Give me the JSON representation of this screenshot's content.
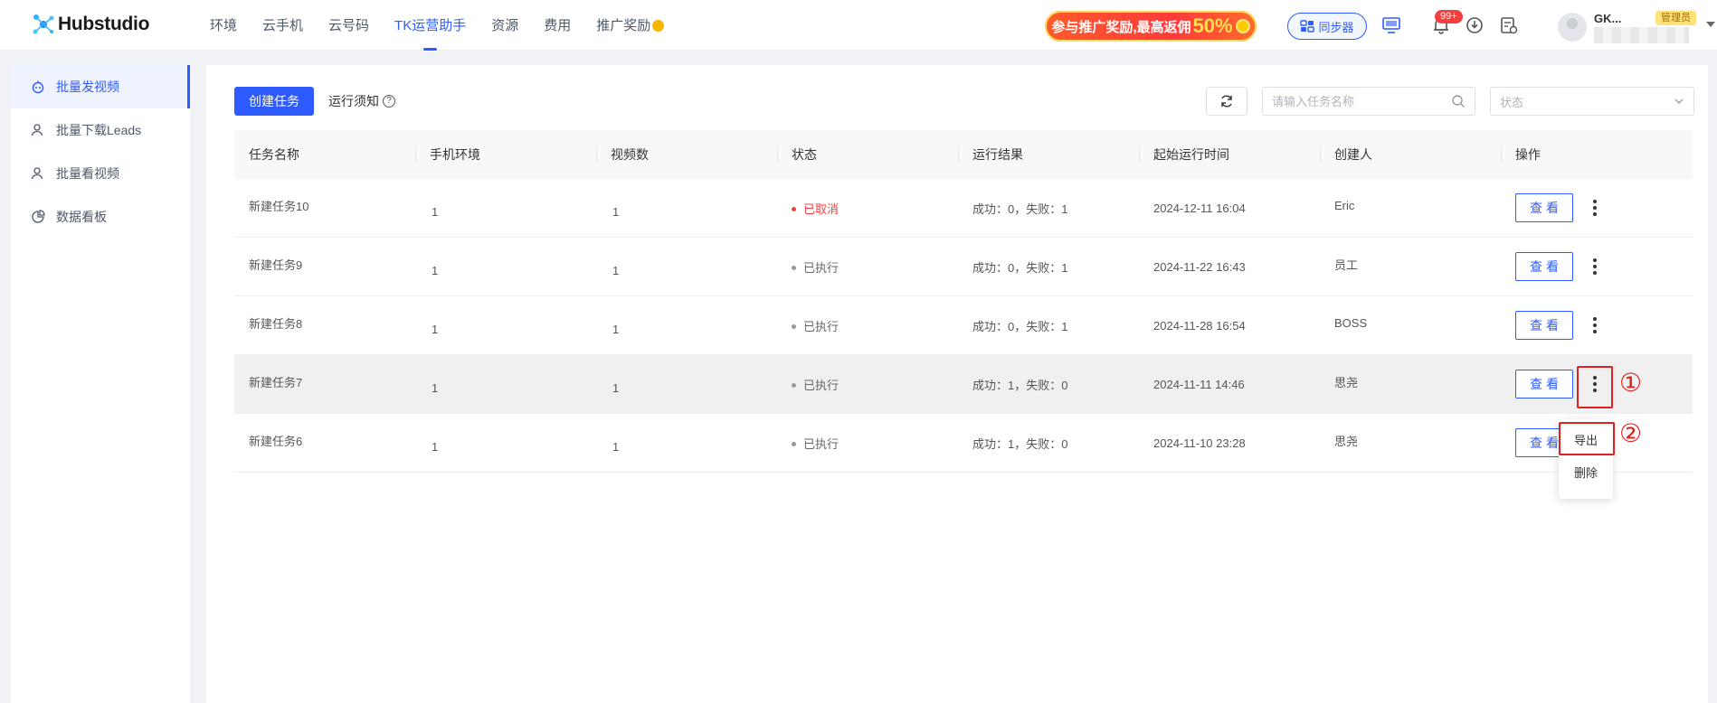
{
  "app": {
    "logo_text": "Hubstudio"
  },
  "nav": {
    "items": [
      "环境",
      "云手机",
      "云号码",
      "TK运营助手",
      "资源",
      "费用",
      "推广奖励"
    ],
    "active": "TK运营助手"
  },
  "promo": {
    "text": "参与推广奖励,最高返佣",
    "highlight": "50%"
  },
  "sync": {
    "label": "同步器"
  },
  "notifications": {
    "badge": "99+"
  },
  "user": {
    "name": "GK...",
    "tag": "管理员"
  },
  "sidebar": {
    "items": [
      {
        "label": "批量发视频",
        "icon": "upload-robot-icon",
        "active": true
      },
      {
        "label": "批量下载Leads",
        "icon": "user-download-icon",
        "active": false
      },
      {
        "label": "批量看视频",
        "icon": "user-watch-icon",
        "active": false
      },
      {
        "label": "数据看板",
        "icon": "chart-pie-icon",
        "active": false
      }
    ]
  },
  "toolbar": {
    "create_label": "创建任务",
    "notice_label": "运行须知",
    "search_placeholder": "请输入任务名称",
    "status_placeholder": "状态"
  },
  "table": {
    "headers": [
      "任务名称",
      "手机环境",
      "视频数",
      "状态",
      "运行结果",
      "起始运行时间",
      "创建人",
      "操作"
    ],
    "rows": [
      {
        "name": "新建任务10",
        "env": "1",
        "videos": "1",
        "status": "已取消",
        "result": "成功：0，失败：1",
        "time": "2024-12-11 16:04",
        "creator": "Eric"
      },
      {
        "name": "新建任务9",
        "env": "1",
        "videos": "1",
        "status": "已执行",
        "result": "成功：0，失败：1",
        "time": "2024-11-22 16:43",
        "creator": "员工"
      },
      {
        "name": "新建任务8",
        "env": "1",
        "videos": "1",
        "status": "已执行",
        "result": "成功：0，失败：1",
        "time": "2024-11-28 16:54",
        "creator": "BOSS"
      },
      {
        "name": "新建任务7",
        "env": "1",
        "videos": "1",
        "status": "已执行",
        "result": "成功：1，失败：0",
        "time": "2024-11-11 14:46",
        "creator": "思尧"
      },
      {
        "name": "新建任务6",
        "env": "1",
        "videos": "1",
        "status": "已执行",
        "result": "成功：1，失败：0",
        "time": "2024-11-10 23:28",
        "creator": "思尧"
      }
    ],
    "view_label": "查看"
  },
  "menu": {
    "export_label": "导出",
    "delete_label": "删除"
  },
  "annotations": {
    "one": "①",
    "two": "②"
  },
  "colors": {
    "accent": "#2e5bff",
    "danger": "#f53f3f",
    "annotation": "#e02020"
  }
}
